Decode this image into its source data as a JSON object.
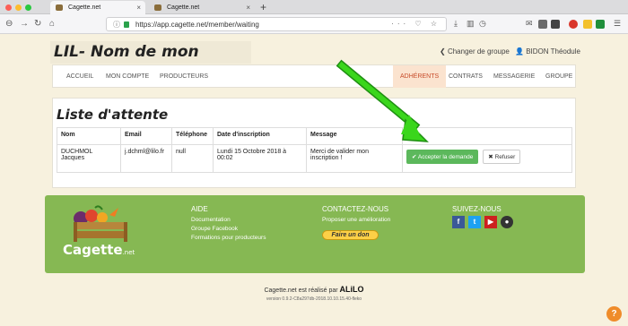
{
  "browser": {
    "tabs": [
      {
        "label": "Cagette.net"
      },
      {
        "label": "Cagette.net"
      }
    ],
    "new_tab": "+",
    "url_domain": "https://app.cagette.net",
    "url_path": "/member/waiting",
    "url_actions": "··· ♡ ☆"
  },
  "header": {
    "group_title": "LIL- Nom de mon groupe",
    "change_group": "Changer de groupe",
    "user_name": "BIDON Théodule"
  },
  "menu": {
    "left": [
      "ACCUEIL",
      "MON COMPTE",
      "PRODUCTEURS"
    ],
    "right": [
      "ADHÉRENTS",
      "CONTRATS",
      "MESSAGERIE",
      "GROUPE"
    ],
    "active": "ADHÉRENTS"
  },
  "waiting_list": {
    "title": "Liste d'attente",
    "columns": [
      "Nom",
      "Email",
      "Téléphone",
      "Date d'inscription",
      "Message",
      ""
    ],
    "rows": [
      {
        "name_line1": "DUCHMOL",
        "name_line2": "Jacques",
        "email": "j.dchml@lilo.fr",
        "phone": "null",
        "date_line1": "Lundi 15 Octobre 2018 à",
        "date_line2": "00:02",
        "message_line1": "Merci de valider mon",
        "message_line2": "inscription !",
        "accept_label": "Accepter la demande",
        "refuse_label": "Refuser"
      }
    ]
  },
  "footer": {
    "brand": "Cagette",
    "brand_suffix": ".net",
    "aide": {
      "heading": "AIDE",
      "links": [
        "Documentation",
        "Groupe Facebook",
        "Formations pour producteurs"
      ]
    },
    "contact": {
      "heading": "CONTACTEZ-NOUS",
      "link": "Proposer une amélioration",
      "donate": "Faire un don"
    },
    "social": {
      "heading": "SUIVEZ-NOUS",
      "icons": [
        {
          "name": "facebook",
          "glyph": "f",
          "color": "#3b5998"
        },
        {
          "name": "twitter",
          "glyph": "t",
          "color": "#1da1f2"
        },
        {
          "name": "youtube",
          "glyph": "▶",
          "color": "#cd201f"
        },
        {
          "name": "github",
          "glyph": "●",
          "color": "#333333"
        }
      ]
    }
  },
  "credit": {
    "text": "Cagette.net est réalisé par",
    "company": "ALiLO",
    "version": "version 0.9.2-C8a297db-2018.10.10.15.40-fleko"
  },
  "colors": {
    "accent_green": "#86b853",
    "button_green": "#5cb85c",
    "active_menu_bg": "#fbe3cf",
    "active_menu_text": "#c84c2a",
    "page_bg": "#f7f1de",
    "annotation_arrow": "#3ad61c"
  }
}
